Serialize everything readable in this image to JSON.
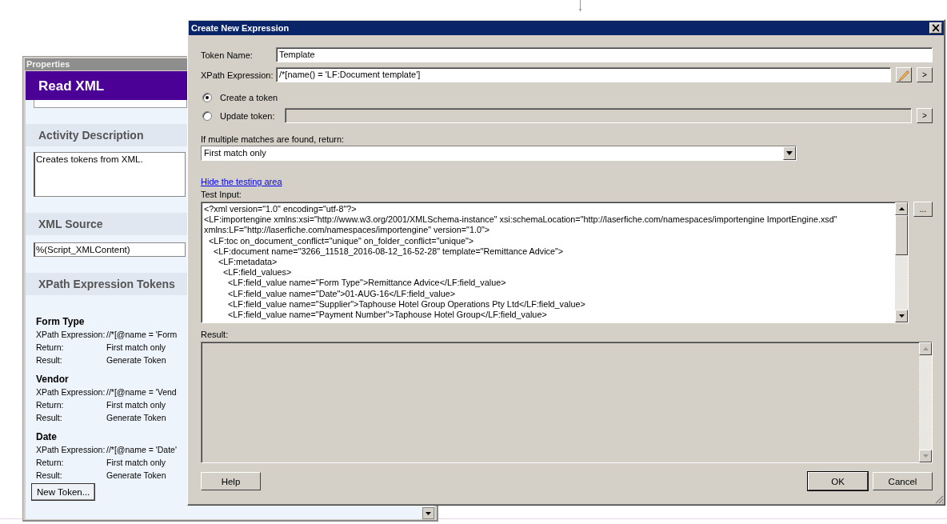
{
  "properties": {
    "title": "Properties",
    "header": "Read XML",
    "sections": [
      {
        "heading": "Activity Description",
        "kind": "textarea",
        "value": "Creates tokens from XML."
      },
      {
        "heading": "XML Source",
        "kind": "field",
        "value": "%(Script_XMLContent)"
      },
      {
        "heading": "XPath Expression Tokens",
        "kind": "tokens"
      }
    ],
    "tokens": [
      {
        "name": "Form Type",
        "rows": [
          {
            "label": "XPath Expression:",
            "value": "//*[@name = 'Form"
          },
          {
            "label": "Return:",
            "value": "First match only"
          },
          {
            "label": "Result:",
            "value": "Generate Token"
          }
        ]
      },
      {
        "name": "Vendor",
        "rows": [
          {
            "label": "XPath Expression:",
            "value": "//*[@name = 'Vend"
          },
          {
            "label": "Return:",
            "value": "First match only"
          },
          {
            "label": "Result:",
            "value": "Generate Token"
          }
        ]
      },
      {
        "name": "Date",
        "rows": [
          {
            "label": "XPath Expression:",
            "value": "//*[@name = 'Date'"
          },
          {
            "label": "Return:",
            "value": "First match only"
          },
          {
            "label": "Result:",
            "value": "Generate Token"
          }
        ]
      }
    ],
    "new_token_button": "New Token..."
  },
  "dialog": {
    "title": "Create New Expression",
    "close": "×",
    "token_name": {
      "label": "Token Name:",
      "value": "Template"
    },
    "xpath": {
      "label": "XPath Expression:",
      "value": "/*[name() = 'LF:Document template']",
      "more": ">"
    },
    "options": [
      {
        "label": "Create a token",
        "selected": true,
        "kind": "plain"
      },
      {
        "label": "Update token:",
        "selected": false,
        "kind": "field",
        "more": ">"
      }
    ],
    "multiple_matches": {
      "label": "If multiple matches are found, return:",
      "value": "First match only"
    },
    "testing_link": "Hide the testing area",
    "test_input": {
      "label": "Test Input:",
      "browse": "...",
      "lines": [
        "<?xml version=\"1.0\" encoding=\"utf-8\"?>",
        "<LF:importengine xmlns:xsi=\"http://www.w3.org/2001/XMLSchema-instance\" xsi:schemaLocation=\"http://laserfiche.com/namespaces/importengine ImportEngine.xsd\"",
        "xmlns:LF=\"http://laserfiche.com/namespaces/importengine\" version=\"1.0\">",
        "  <LF:toc on_document_conflict=\"unique\" on_folder_conflict=\"unique\">",
        "    <LF:document name=\"3266_11518_2016-08-12_16-52-28\" template=\"Remittance Advice\">",
        "      <LF:metadata>",
        "        <LF:field_values>",
        "          <LF:field_value name=\"Form Type\">Remittance Advice</LF:field_value>",
        "          <LF:field_value name=\"Date\">01-AUG-16</LF:field_value>",
        "          <LF:field_value name=\"Supplier\">Taphouse Hotel Group Operations Pty Ltd</LF:field_value>",
        "          <LF:field_value name=\"Payment Number\">Taphouse Hotel Group</LF:field_value>"
      ]
    },
    "result": {
      "label": "Result:"
    },
    "buttons": [
      {
        "label": "Help",
        "kind": "help"
      },
      {
        "label": "OK",
        "kind": "default"
      },
      {
        "label": "Cancel",
        "kind": "cancel"
      }
    ]
  }
}
